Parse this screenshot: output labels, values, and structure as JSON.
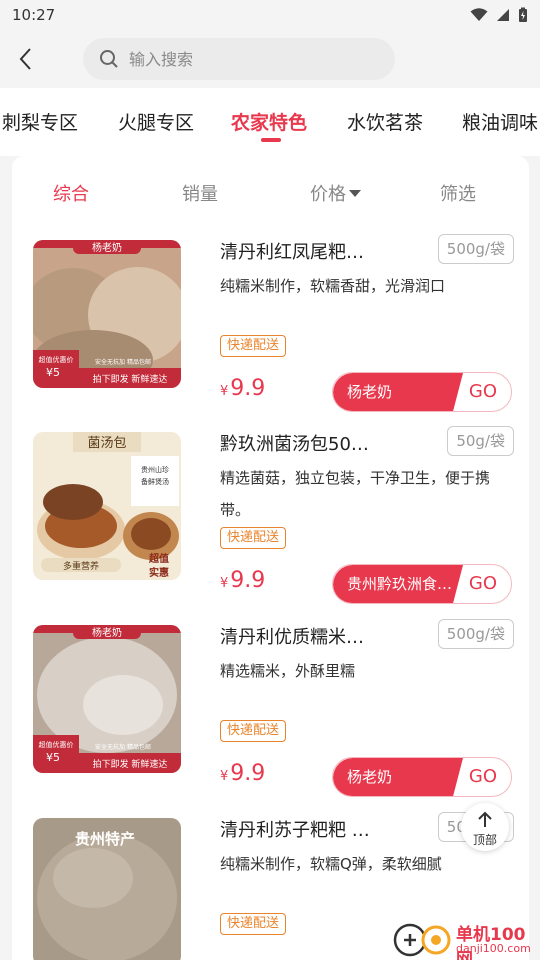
{
  "status": {
    "time": "10:27"
  },
  "search": {
    "placeholder": "输入搜索"
  },
  "categories": [
    {
      "label": "刺梨专区"
    },
    {
      "label": "火腿专区"
    },
    {
      "label": "农家特色"
    },
    {
      "label": "水饮茗茶"
    },
    {
      "label": "粮油调味"
    }
  ],
  "active_category": "农家特色",
  "sort": {
    "items": [
      {
        "label": "综合"
      },
      {
        "label": "销量"
      },
      {
        "label": "价格"
      },
      {
        "label": "筛选"
      }
    ]
  },
  "products": [
    {
      "title": "清丹利红凤尾粑…",
      "spec": "500g/袋",
      "desc": "纯糯米制作，软糯香甜，光滑润口",
      "tag": "快递配送",
      "currency": "¥",
      "price": "9.9",
      "shop": "杨老奶",
      "go": "GO",
      "thumb_text": {
        "banner": "杨老奶",
        "left": "超值优惠价",
        "price": "¥5",
        "bottom": "拍下即发 新鲜速达",
        "mid": "安全无抗加 精品包邮"
      }
    },
    {
      "title": "黔玖洲菌汤包50…",
      "spec": "50g/袋",
      "desc": "精选菌菇，独立包装，干净卫生，便于携带。",
      "tag": "快递配送",
      "currency": "¥",
      "price": "9.9",
      "shop": "贵州黔玖洲食…",
      "go": "GO",
      "thumb_text": {
        "banner": "菌汤包",
        "side": "贵州山珍 备鲜煲汤",
        "bottom": "多重营养",
        "badge": "超值实惠"
      }
    },
    {
      "title": "清丹利优质糯米…",
      "spec": "500g/袋",
      "desc": "精选糯米，外酥里糯",
      "tag": "快递配送",
      "currency": "¥",
      "price": "9.9",
      "shop": "杨老奶",
      "go": "GO",
      "thumb_text": {
        "banner": "杨老奶",
        "left": "超值优惠价",
        "price": "¥5",
        "bottom": "拍下即发 新鲜速达",
        "mid": "安全无抗加 精品包邮"
      }
    },
    {
      "title": "清丹利苏子粑粑 …",
      "spec": "500g/袋",
      "desc": "纯糯米制作，软糯Q弹，柔软细腻",
      "tag": "快递配送",
      "thumb_text": {
        "banner": "贵州特产"
      }
    }
  ],
  "top_button": {
    "label": "顶部"
  },
  "watermark": {
    "name": "单机100网",
    "url": "danji100.com"
  },
  "colors": {
    "accent": "#e8384d",
    "tag": "#e8842c"
  }
}
